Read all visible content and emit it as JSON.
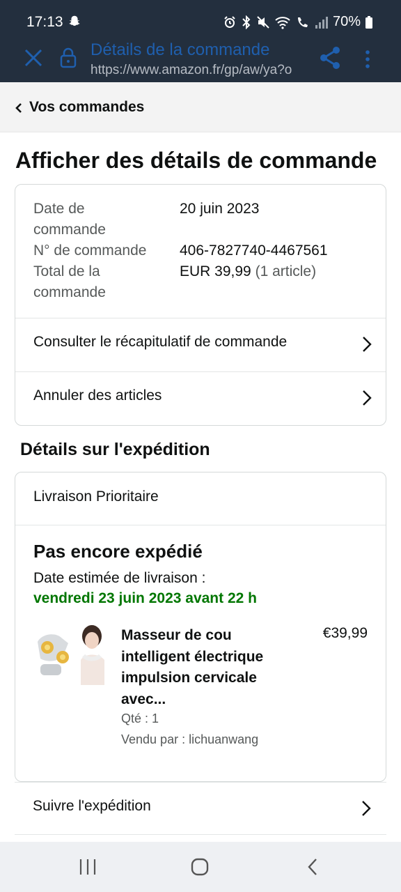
{
  "status_bar": {
    "time": "17:13",
    "battery": "70%",
    "icons": [
      "snapchat-icon",
      "alarm-icon",
      "bluetooth-icon",
      "mute-icon",
      "wifi-icon",
      "wifi-call-icon",
      "signal-icon",
      "battery-icon"
    ]
  },
  "browser": {
    "title": "Détails de la commande",
    "url": "https://www.amazon.fr/gp/aw/ya?o",
    "icons": [
      "close-icon",
      "lock-icon",
      "share-icon",
      "more-icon"
    ]
  },
  "breadcrumb": {
    "label": "Vos commandes"
  },
  "page_title": "Afficher des détails de commande",
  "order": {
    "date_label_1": "Date de",
    "date_label_2": "commande",
    "date_value": "20 juin 2023",
    "number_label": "N° de commande",
    "number_value": "406-7827740-4467561",
    "total_label_1": "Total de la",
    "total_label_2": "commande",
    "total_value": "EUR 39,99",
    "total_count": "(1 article)"
  },
  "links": {
    "summary": "Consulter le récapitulatif de commande",
    "cancel": "Annuler des articles",
    "track": "Suivre l'expédition"
  },
  "shipping": {
    "heading": "Détails sur l'expédition",
    "type": "Livraison Prioritaire",
    "status": "Pas encore expédié",
    "eta_label": "Date estimée de livraison :",
    "eta_date": "vendredi 23 juin 2023 avant 22 h"
  },
  "product": {
    "name": "Masseur de cou intelligent électrique impulsion cervicale avec...",
    "price": "€39,99",
    "qty": "Qté : 1",
    "seller": "Vendu par : lichuanwang"
  },
  "colors": {
    "header": "#232f3e",
    "accent_blue": "#1f5fae",
    "delivery_green": "#007600"
  }
}
